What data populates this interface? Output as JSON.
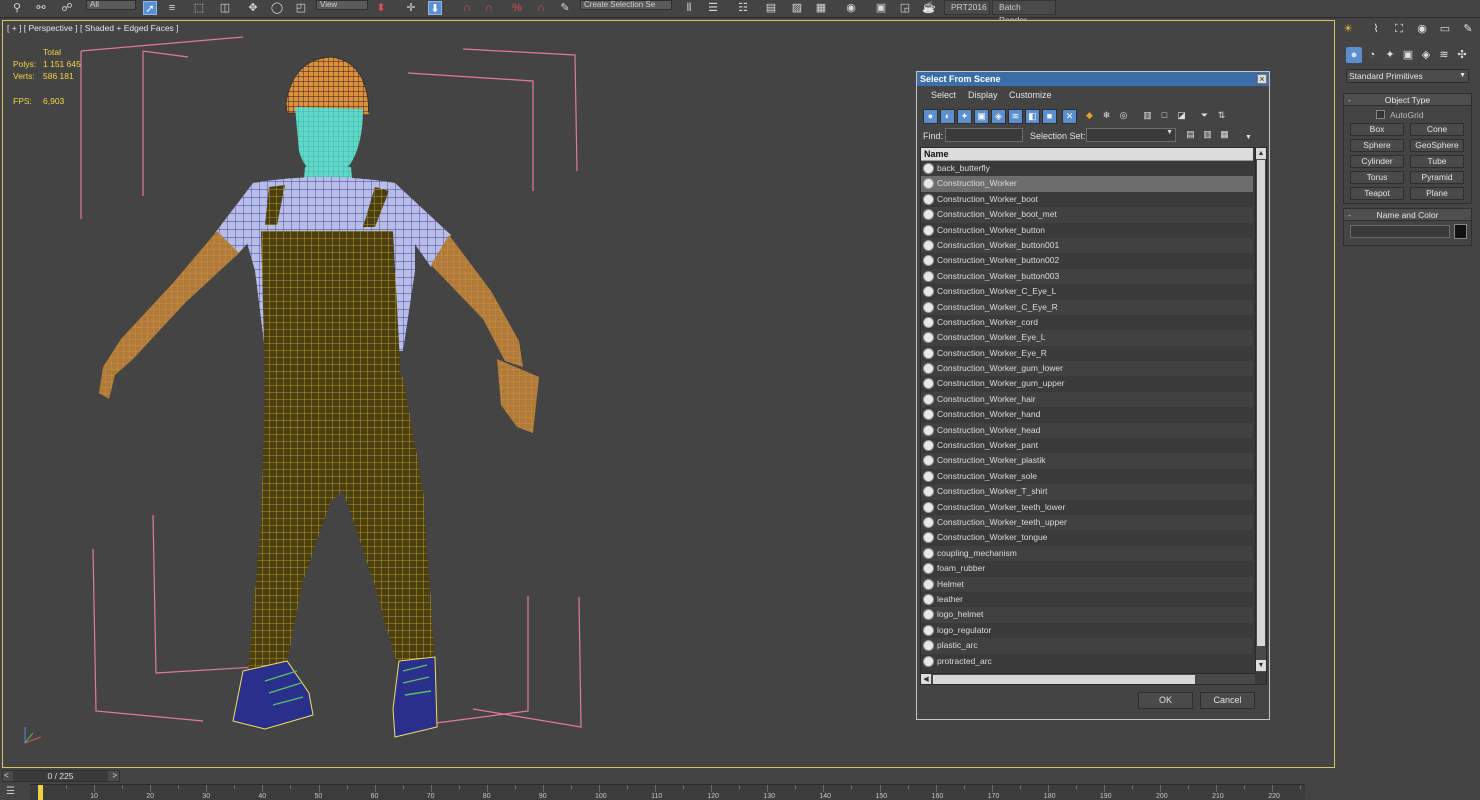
{
  "toolbar": {
    "filter_value": "All",
    "view_value": "View",
    "selection_set_placeholder": "Create Selection Se",
    "prt_label": "PRT2016",
    "batch_render_label": "Batch Render..."
  },
  "viewport": {
    "label": "[ + ] [ Perspective ] [ Shaded + Edged Faces ]",
    "stats": {
      "total_label": "Total",
      "polys_label": "Polys:",
      "polys_value": "1 151 645",
      "verts_label": "Verts:",
      "verts_value": "586 181",
      "fps_label": "FPS:",
      "fps_value": "6,903"
    }
  },
  "dialog": {
    "title": "Select From Scene",
    "close": "×",
    "menu": [
      "Select",
      "Display",
      "Customize"
    ],
    "find_label": "Find:",
    "selection_set_label": "Selection Set:",
    "column_name": "Name",
    "rows": [
      "back_butterfly",
      "Construction_Worker",
      "Construction_Worker_boot",
      "Construction_Worker_boot_met",
      "Construction_Worker_button",
      "Construction_Worker_button001",
      "Construction_Worker_button002",
      "Construction_Worker_button003",
      "Construction_Worker_C_Eye_L",
      "Construction_Worker_C_Eye_R",
      "Construction_Worker_cord",
      "Construction_Worker_Eye_L",
      "Construction_Worker_Eye_R",
      "Construction_Worker_gum_lower",
      "Construction_Worker_gum_upper",
      "Construction_Worker_hair",
      "Construction_Worker_hand",
      "Construction_Worker_head",
      "Construction_Worker_pant",
      "Construction_Worker_plastik",
      "Construction_Worker_sole",
      "Construction_Worker_T_shirt",
      "Construction_Worker_teeth_lower",
      "Construction_Worker_teeth_upper",
      "Construction_Worker_tongue",
      "coupling_mechanism",
      "foam_rubber",
      "Helmet",
      "leather",
      "logo_helmet",
      "logo_regulator",
      "plastic_arc",
      "protracted_arc"
    ],
    "selected_row": "Construction_Worker",
    "ok_label": "OK",
    "cancel_label": "Cancel"
  },
  "command_panel": {
    "category_dropdown": "Standard Primitives",
    "object_type_title": "Object Type",
    "autogrid_label": "AutoGrid",
    "primitives": [
      "Box",
      "Cone",
      "Sphere",
      "GeoSphere",
      "Cylinder",
      "Tube",
      "Torus",
      "Pyramid",
      "Teapot",
      "Plane"
    ],
    "name_color_title": "Name and Color",
    "object_color": "#111111"
  },
  "timeline": {
    "frame_display": "0 / 225",
    "prev": "<",
    "next": ">",
    "ticks": [
      "10",
      "20",
      "30",
      "40",
      "50",
      "60",
      "70",
      "80",
      "90",
      "100",
      "110",
      "120",
      "130",
      "140",
      "150",
      "160",
      "170",
      "180",
      "190",
      "200",
      "210",
      "220"
    ]
  },
  "colors": {
    "accent_blue": "#5a8fd0",
    "title_bar": "#3b6ea9",
    "stats_yellow": "#f5d742",
    "bbox_pink": "#e07aa0",
    "wire_yellow": "#d4b020",
    "shirt_blue": "#3a3fa8"
  }
}
